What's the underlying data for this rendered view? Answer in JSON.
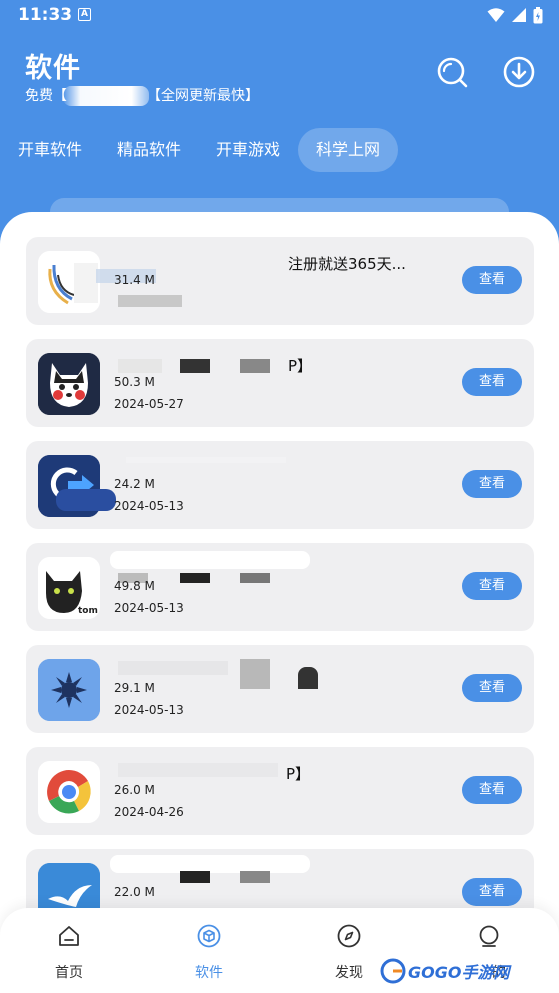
{
  "status_bar": {
    "time": "11:33",
    "notification_badge": "A"
  },
  "header": {
    "title": "软件",
    "subtitle_prefix": "免费【",
    "subtitle_suffix": "【全网更新最快】"
  },
  "tabs": [
    {
      "label": "开車软件",
      "active": false
    },
    {
      "label": "精品软件",
      "active": false
    },
    {
      "label": "开車游戏",
      "active": false
    },
    {
      "label": "科学上网",
      "active": true
    }
  ],
  "apps": [
    {
      "name": "注册就送365天...",
      "size": "31.4 M",
      "date": "",
      "button": "查看"
    },
    {
      "name": "P】",
      "size": "50.3 M",
      "date": "2024-05-27",
      "button": "查看"
    },
    {
      "name": "",
      "size": "24.2 M",
      "date": "2024-05-13",
      "button": "查看"
    },
    {
      "name": "",
      "size": "49.8 M",
      "date": "2024-05-13",
      "button": "查看"
    },
    {
      "name": "",
      "size": "29.1 M",
      "date": "2024-05-13",
      "button": "查看"
    },
    {
      "name": "P】",
      "size": "26.0 M",
      "date": "2024-04-26",
      "button": "查看"
    },
    {
      "name": "",
      "size": "22.0 M",
      "date": "",
      "button": "查看"
    }
  ],
  "bottom_nav": [
    {
      "label": "首页",
      "icon": "home-icon",
      "active": false
    },
    {
      "label": "软件",
      "icon": "cube-icon",
      "active": true
    },
    {
      "label": "发现",
      "icon": "compass-icon",
      "active": false
    },
    {
      "label": "的",
      "icon": "profile-icon",
      "active": false
    }
  ],
  "watermark": {
    "text": "GOGO手游网"
  },
  "colors": {
    "primary": "#4a90e6",
    "card_bg": "#efeff1"
  }
}
